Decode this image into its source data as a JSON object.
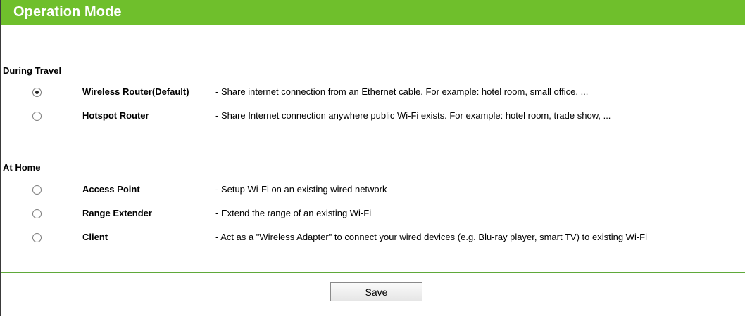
{
  "header": {
    "title": "Operation Mode"
  },
  "sections": [
    {
      "title": "During Travel",
      "options": [
        {
          "label": "Wireless Router(Default)",
          "description": "- Share internet connection from an Ethernet cable. For example: hotel room, small office, ...",
          "selected": true
        },
        {
          "label": "Hotspot Router",
          "description": "- Share Internet connection anywhere public Wi-Fi exists. For example: hotel room, trade show, ...",
          "selected": false
        }
      ]
    },
    {
      "title": "At Home",
      "options": [
        {
          "label": "Access Point",
          "description": "- Setup Wi-Fi on an existing wired network",
          "selected": false
        },
        {
          "label": "Range Extender",
          "description": "- Extend the range of an existing Wi-Fi",
          "selected": false
        },
        {
          "label": "Client",
          "description": "- Act as a \"Wireless Adapter\" to connect your wired devices (e.g. Blu-ray player, smart TV) to existing Wi-Fi",
          "selected": false
        }
      ]
    }
  ],
  "actions": {
    "save_label": "Save"
  },
  "colors": {
    "header_bg": "#6fbf2c",
    "header_text": "#ffffff",
    "divider": "#5fa93a"
  }
}
